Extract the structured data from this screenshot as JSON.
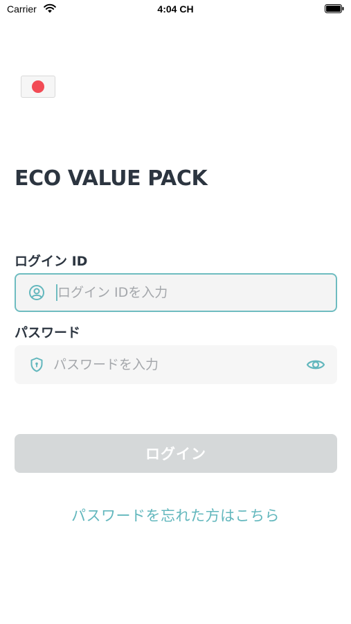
{
  "status_bar": {
    "carrier": "Carrier",
    "time": "4:04 CH",
    "icons": [
      "wifi-icon",
      "battery-icon"
    ]
  },
  "language": {
    "flag": "japan-flag-icon",
    "flag_color": "#f24b55"
  },
  "app_title": "ECO VALUE PACK",
  "login_form": {
    "login_id_label": "ログイン ID",
    "login_id_placeholder": "ログイン IDを入力",
    "login_id_value": "",
    "login_id_icon": "user-circle-icon",
    "password_label": "パスワード",
    "password_placeholder": "パスワードを入力",
    "password_value": "",
    "password_icon": "shield-lock-icon",
    "visibility_icon": "eye-icon",
    "submit_label": "ログイン",
    "forgot_link": "パスワードを忘れた方はこちら"
  },
  "colors": {
    "accent": "#62b7bd",
    "title": "#2c3540",
    "button_disabled": "#d5d8d9",
    "input_background": "#f4f4f4"
  }
}
